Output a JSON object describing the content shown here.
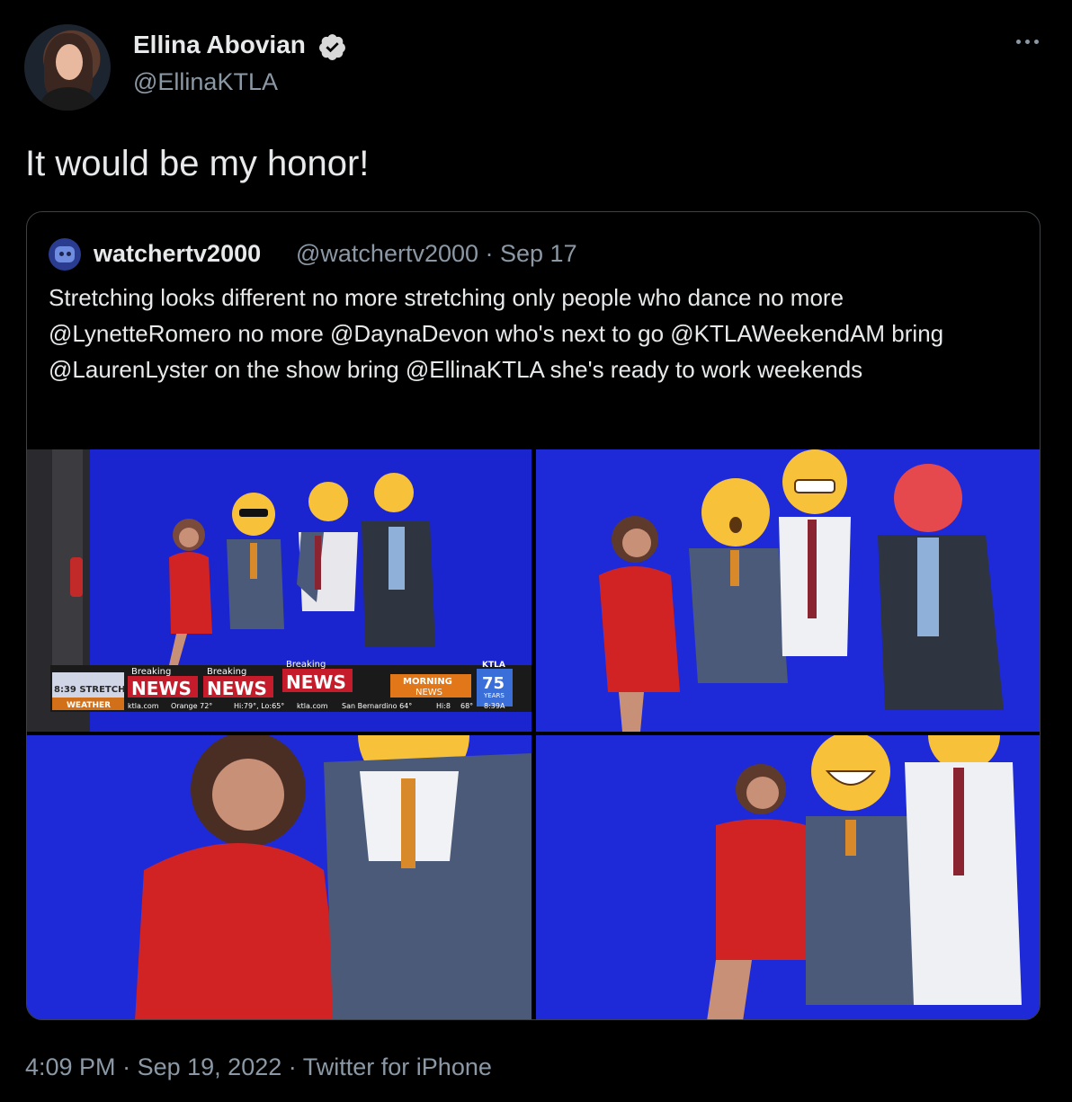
{
  "author": {
    "name": "Ellina Abovian",
    "handle": "@EllinaKTLA",
    "verified": true
  },
  "tweet": {
    "text": "It would be my honor!",
    "time": "4:09 PM",
    "separator1": "·",
    "date": "Sep 19, 2022",
    "separator2": "·",
    "source": "Twitter for iPhone"
  },
  "quoted": {
    "name": "watchertv2000",
    "handle": "@watchertv2000 · Sep 17",
    "text": "Stretching looks different no more stretching only people who dance no more @LynetteRomero no more @DaynaDevon who's next to go @KTLAWeekendAM bring @LaurenLyster on the show bring @EllinaKTLA she's ready to work weekends"
  },
  "ticker": {
    "stretch": "8:39 STRETCH",
    "weather": "WEATHER",
    "breaking1": "Breaking",
    "news1": "NEWS",
    "breaking2": "Breaking",
    "news2": "NEWS",
    "breaking3": "Breaking",
    "news3": "NEWS",
    "morning": "MORNING",
    "morning_news": "NEWS",
    "station": "KTLA",
    "years_num": "75",
    "years": "YEARS",
    "ktla1": "ktla.com",
    "orange": "Orange 72°",
    "hilo": "Hi:79°, Lo:65°",
    "ktla2": "ktla.com",
    "sanbern": "San Bernardino 64°",
    "hi": "Hi:8",
    "temp": "68°",
    "clock": "8:39A"
  },
  "colors": {
    "background": "#000000",
    "primary_text": "#e7e9ea",
    "secondary_text": "#8b98a5",
    "verified_badge": "#d9d9d9",
    "border": "#3e4144",
    "studio_blue": "#1b27d6"
  },
  "icons": [
    "verified-badge-icon",
    "more-options-icon"
  ]
}
